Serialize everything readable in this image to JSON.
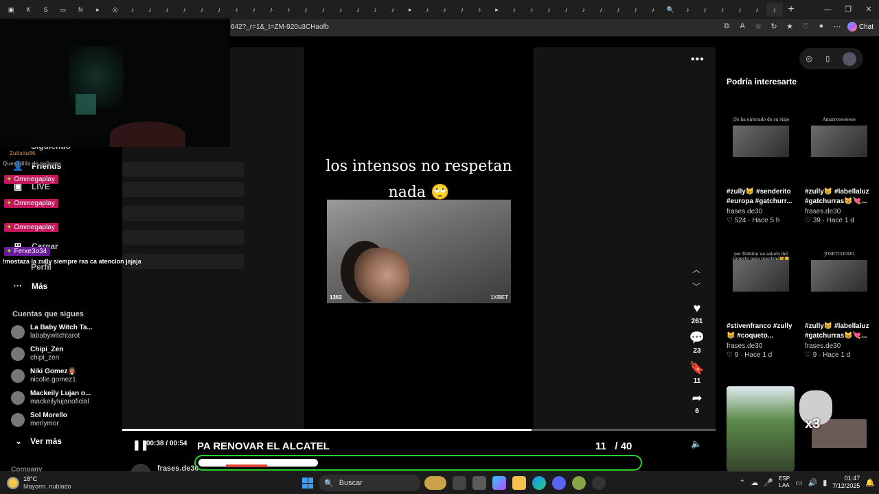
{
  "browser": {
    "url": "642?_r=1&_t=ZM-920u3CHaofb",
    "chat_label": "Chat"
  },
  "sidebar": {
    "items": [
      {
        "icon": "users-icon",
        "label": "Friends"
      },
      {
        "icon": "live-icon",
        "label": "LIVE"
      },
      {
        "icon": "upload-icon",
        "label": "Cargar"
      },
      {
        "icon": "more-icon",
        "label": "Más"
      }
    ],
    "peek_labels": [
      "Siguiendo",
      "Perfil"
    ],
    "following_title": "Cuentas que sigues",
    "accounts": [
      {
        "name": "La Baby Witch Ta...",
        "handle": "lababywitchtarot"
      },
      {
        "name": "Chipi_Zen",
        "handle": "chipi_zen"
      },
      {
        "name": "Niki Gomez🧛🏽",
        "handle": "nicolle.gomez1"
      },
      {
        "name": "Mackeily Lujan o...",
        "handle": "mackeilylujanoficial"
      },
      {
        "name": "Sol Morello",
        "handle": "merlymor"
      }
    ],
    "see_more": "Ver más",
    "company": "Company"
  },
  "stream_chat": {
    "badges": [
      {
        "user": "Ommegaplay"
      },
      {
        "user": "Ommegaplay"
      },
      {
        "user": "Ommegaplay"
      },
      {
        "user": "Ferxe3o34"
      }
    ],
    "faint_users": [
      "Zullaitu96",
      "Quesadilla de señoras"
    ],
    "message": "!mostaza la zully siempre ras ca atencion jajaja"
  },
  "video": {
    "caption_line1": "los intensos no respetan",
    "caption_line2": "nada 🙄",
    "watermark_left": "1362",
    "watermark_right": "1XBET",
    "time_current": "00:38",
    "time_total": "00:54",
    "time_separator": " / ",
    "progress": 0.69,
    "author_peek": "frases.de30"
  },
  "actions": {
    "likes": "261",
    "comments": "23",
    "saves": "11",
    "shares": "6"
  },
  "recommendations": {
    "title": "Podría interesarte",
    "cards": [
      {
        "thumb_text": "¡Se ha enterado de su viaje",
        "desc1": "#zully😸 #senderito",
        "desc2": "#europa #gatchurr...",
        "author": "frases.de30",
        "likes": "524",
        "time": "Hace 5 h"
      },
      {
        "thumb_text": "Amarrooooooos",
        "desc1": "#zully😸 #labellaluz",
        "desc2": "#gatchurras😸💘...",
        "author": "frases.de30",
        "likes": "39",
        "time": "Hace 1 d"
      },
      {
        "thumb_text": "por fiiiiiiiiin un saludo del coqueto para nosotras😸😊",
        "desc1": "#stivenfranco #zully",
        "desc2": "😸 #coqueto...",
        "author": "frases.de30",
        "likes": "9",
        "time": "Hace 1 d"
      },
      {
        "thumb_text": "JOSETCOOOO",
        "desc1": "#zully😸 #labellaluz",
        "desc2": "#gatchurras😸💘...",
        "author": "frases.de30",
        "likes": "9",
        "time": "Hace 1 d"
      }
    ],
    "sticker_text": "x3"
  },
  "stream_overlay": {
    "title": "PA RENOVAR EL ALCATEL",
    "count": "11",
    "count_total": "/ 40",
    "bar_progress": 0.27
  },
  "taskbar": {
    "temp": "18°C",
    "weather": "Mayorm. nublado",
    "search": "Buscar",
    "lang1": "ESP",
    "lang2": "LAA",
    "time": "01:47",
    "date": "7/12/2025"
  }
}
